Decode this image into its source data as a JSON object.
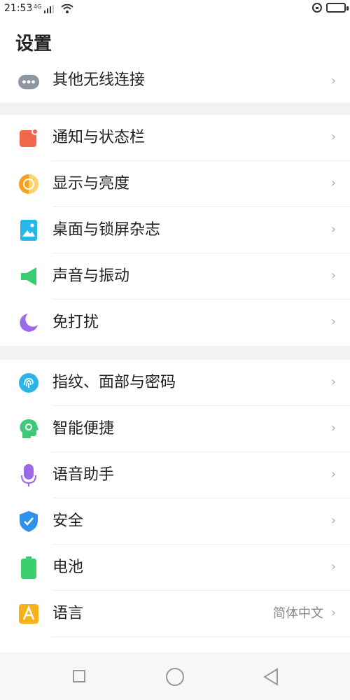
{
  "status_bar": {
    "time": "21:53",
    "network": "4G"
  },
  "header": {
    "title": "设置"
  },
  "sections": [
    {
      "items": [
        {
          "label": "其他无线连接",
          "icon": "more-dots-icon"
        }
      ]
    },
    {
      "items": [
        {
          "label": "通知与状态栏",
          "icon": "notification-icon"
        },
        {
          "label": "显示与亮度",
          "icon": "display-brightness-icon"
        },
        {
          "label": "桌面与锁屏杂志",
          "icon": "wallpaper-icon"
        },
        {
          "label": "声音与振动",
          "icon": "speaker-icon"
        },
        {
          "label": "免打扰",
          "icon": "moon-icon"
        }
      ]
    },
    {
      "items": [
        {
          "label": "指纹、面部与密码",
          "icon": "fingerprint-icon"
        },
        {
          "label": "智能便捷",
          "icon": "smart-head-icon"
        },
        {
          "label": "语音助手",
          "icon": "microphone-icon"
        },
        {
          "label": "安全",
          "icon": "shield-icon"
        },
        {
          "label": "电池",
          "icon": "battery-icon"
        },
        {
          "label": "语言",
          "icon": "language-icon",
          "value": "简体中文"
        }
      ]
    }
  ],
  "chevron": "›",
  "colors": {
    "gray_icon": "#8e95a3",
    "notification": "#f2674c",
    "display": "#f6a11e",
    "wallpaper": "#27b8ea",
    "sound": "#39cd72",
    "moon": "#9a6be8",
    "fingerprint": "#2fb4e8",
    "smart": "#3cc97a",
    "mic": "#9b68e6",
    "shield": "#2d92ec",
    "battery": "#3ccd6e",
    "language": "#f6b21b"
  }
}
